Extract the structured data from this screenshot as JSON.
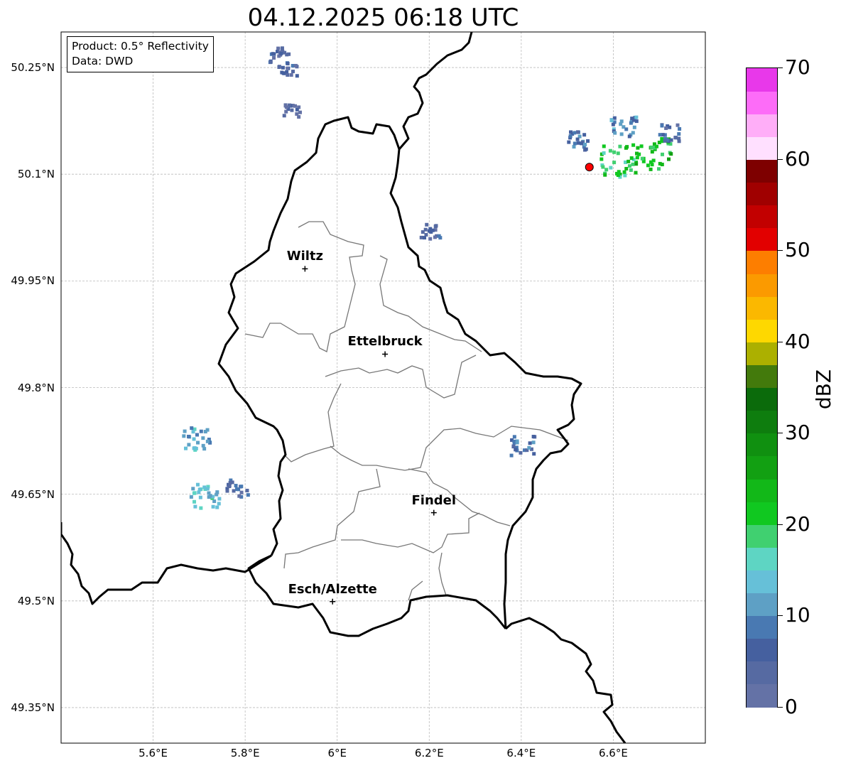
{
  "title": "04.12.2025 06:18 UTC",
  "info": {
    "product": "Product: 0.5° Reflectivity",
    "source": "Data: DWD"
  },
  "map": {
    "lon_range": [
      5.4,
      6.8
    ],
    "lat_range": [
      49.3,
      50.3
    ],
    "lat_ticks": [
      {
        "value": 50.25,
        "label": "50.25°N"
      },
      {
        "value": 50.1,
        "label": "50.1°N"
      },
      {
        "value": 49.95,
        "label": "49.95°N"
      },
      {
        "value": 49.8,
        "label": "49.8°N"
      },
      {
        "value": 49.65,
        "label": "49.65°N"
      },
      {
        "value": 49.5,
        "label": "49.5°N"
      },
      {
        "value": 49.35,
        "label": "49.35°N"
      }
    ],
    "lon_ticks": [
      {
        "value": 5.6,
        "label": "5.6°E"
      },
      {
        "value": 5.8,
        "label": "5.8°E"
      },
      {
        "value": 6.0,
        "label": "6°E"
      },
      {
        "value": 6.2,
        "label": "6.2°E"
      },
      {
        "value": 6.4,
        "label": "6.4°E"
      },
      {
        "value": 6.6,
        "label": "6.6°E"
      }
    ],
    "cities": [
      {
        "name": "Wiltz",
        "lon": 5.93,
        "lat": 49.967
      },
      {
        "name": "Ettelbruck",
        "lon": 6.104,
        "lat": 49.847
      },
      {
        "name": "Findel",
        "lon": 6.21,
        "lat": 49.624
      },
      {
        "name": "Esch/Alzette",
        "lon": 5.99,
        "lat": 49.499
      }
    ],
    "radar_site": {
      "lon": 6.548,
      "lat": 50.11,
      "color": "#ff0000"
    },
    "echoes": [
      {
        "lon": 5.87,
        "lat": 50.27,
        "dbz": 5
      },
      {
        "lon": 5.89,
        "lat": 50.25,
        "dbz": 4
      },
      {
        "lon": 5.9,
        "lat": 50.19,
        "dbz": 3
      },
      {
        "lon": 5.69,
        "lat": 49.73,
        "dbz": 12
      },
      {
        "lon": 5.71,
        "lat": 49.65,
        "dbz": 14
      },
      {
        "lon": 5.78,
        "lat": 49.66,
        "dbz": 6
      },
      {
        "lon": 6.2,
        "lat": 50.02,
        "dbz": 5
      },
      {
        "lon": 6.4,
        "lat": 49.72,
        "dbz": 8
      },
      {
        "lon": 6.52,
        "lat": 50.15,
        "dbz": 8
      },
      {
        "lon": 6.62,
        "lat": 50.17,
        "dbz": 10
      },
      {
        "lon": 6.68,
        "lat": 50.13,
        "dbz": 22
      },
      {
        "lon": 6.61,
        "lat": 50.12,
        "dbz": 20
      },
      {
        "lon": 6.72,
        "lat": 50.16,
        "dbz": 6
      }
    ]
  },
  "colorbar": {
    "label": "dBZ",
    "min": 0,
    "max": 70,
    "ticks": [
      "0",
      "10",
      "20",
      "30",
      "40",
      "50",
      "60",
      "70"
    ],
    "colors": [
      "#6472a6",
      "#566aa2",
      "#45609f",
      "#4979b2",
      "#5ea0c5",
      "#66c0d8",
      "#5ed5c3",
      "#40d070",
      "#10c820",
      "#12b818",
      "#12a012",
      "#109010",
      "#0e7d0e",
      "#0b6b0b",
      "#437a0c",
      "#acb000",
      "#fed800",
      "#fbb800",
      "#fb9a00",
      "#fd7e00",
      "#e20000",
      "#c20000",
      "#a00000",
      "#7e0000",
      "#ffe0ff",
      "#ffaef8",
      "#fd6cf8",
      "#e838ea"
    ]
  }
}
